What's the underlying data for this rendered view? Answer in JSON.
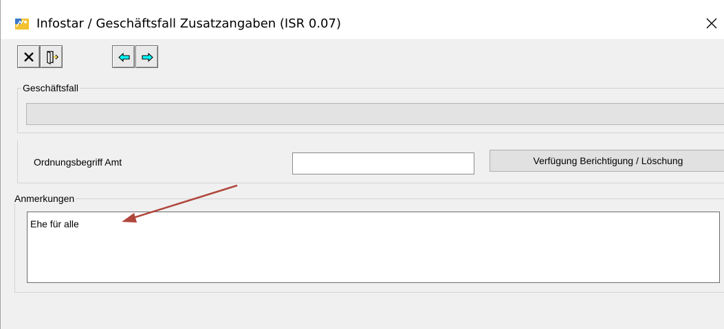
{
  "window": {
    "title": "Infostar / Geschäftsfall Zusatzangaben (ISR 0.07)"
  },
  "toolbar": {
    "buttons": [
      {
        "name": "close-x-icon"
      },
      {
        "name": "exit-door-icon"
      },
      {
        "name": "arrow-left-icon"
      },
      {
        "name": "arrow-right-icon"
      }
    ]
  },
  "geschaeftsfall": {
    "legend": "Geschäftsfall",
    "value": ""
  },
  "ordnung": {
    "label": "Ordnungsbegriff Amt",
    "value": "",
    "button_label": "Verfügung Berichtigung / Löschung"
  },
  "anmerkungen": {
    "legend": "Anmerkungen",
    "text": "Ehe für alle"
  },
  "colors": {
    "annotation_arrow": "#b0473d",
    "toolbar_arrow_fill": "#00ffff"
  }
}
